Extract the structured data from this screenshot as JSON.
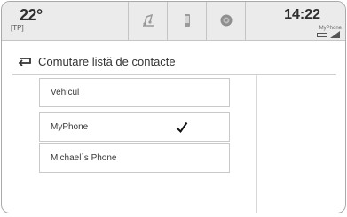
{
  "status": {
    "temperature": "22°",
    "temp_sub": "[TP]",
    "time": "14:22",
    "device_name": "MyPhone",
    "icons": [
      "music-note-icon",
      "phone-icon",
      "apps-icon"
    ]
  },
  "screen": {
    "title": "Comutare listă de contacte",
    "back_icon": "back-arrow-icon"
  },
  "list": {
    "items": [
      {
        "label": "Vehicul",
        "selected": false
      },
      {
        "label": "MyPhone",
        "selected": true
      },
      {
        "label": "Michael`s Phone",
        "selected": false
      }
    ],
    "check_icon": "checkmark-icon"
  }
}
